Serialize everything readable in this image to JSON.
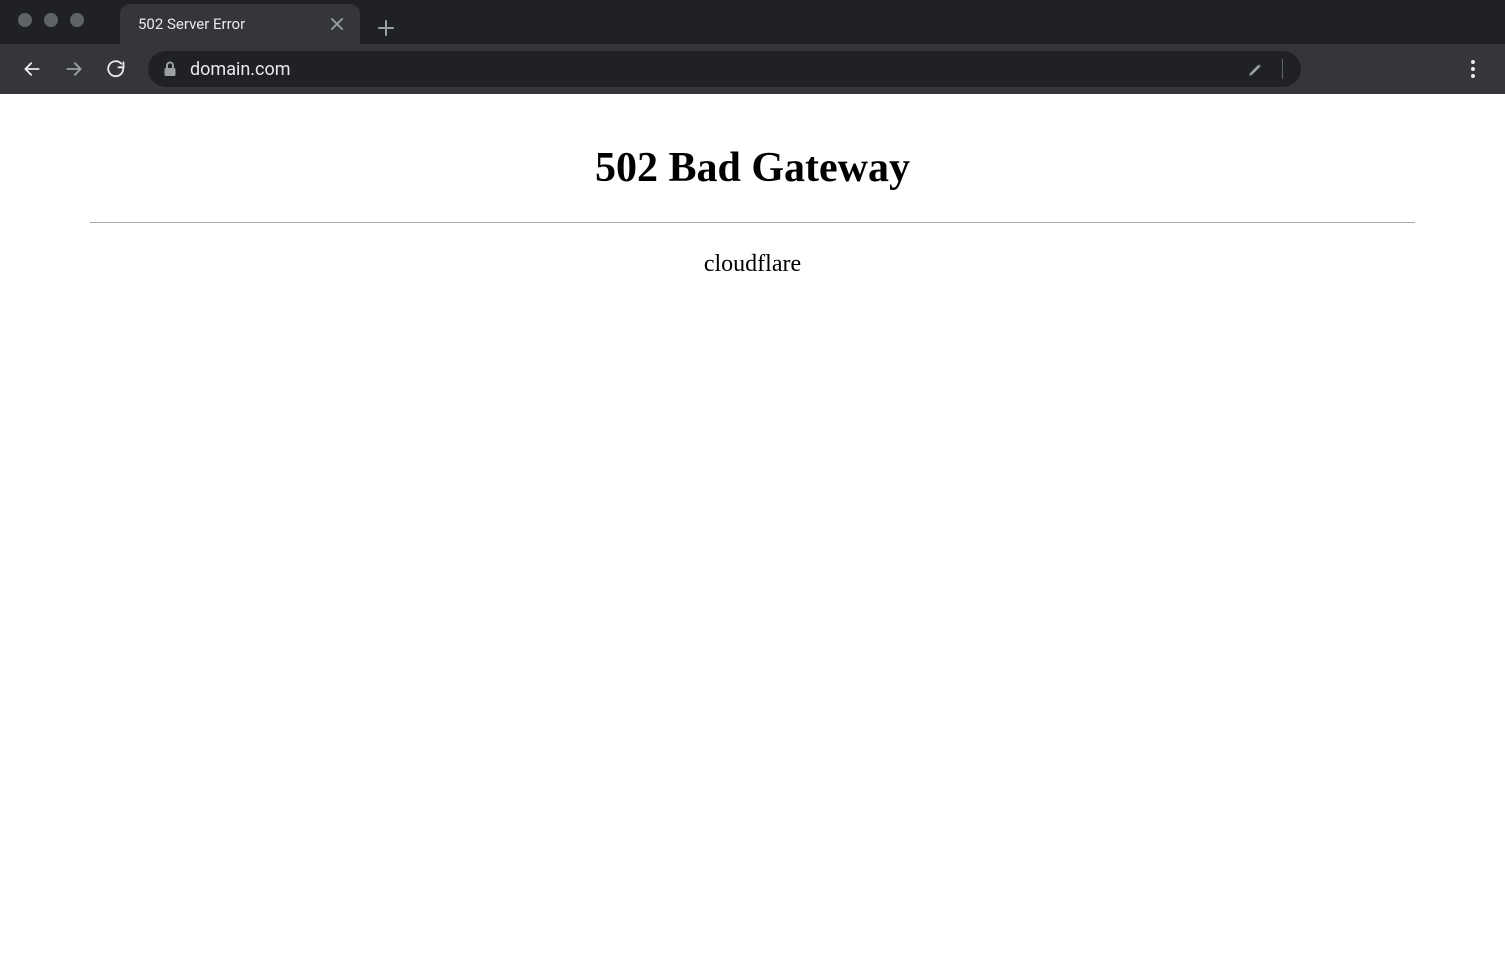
{
  "browser": {
    "tab": {
      "title": "502 Server Error"
    },
    "url": "domain.com"
  },
  "page": {
    "heading": "502 Bad Gateway",
    "server": "cloudflare"
  }
}
